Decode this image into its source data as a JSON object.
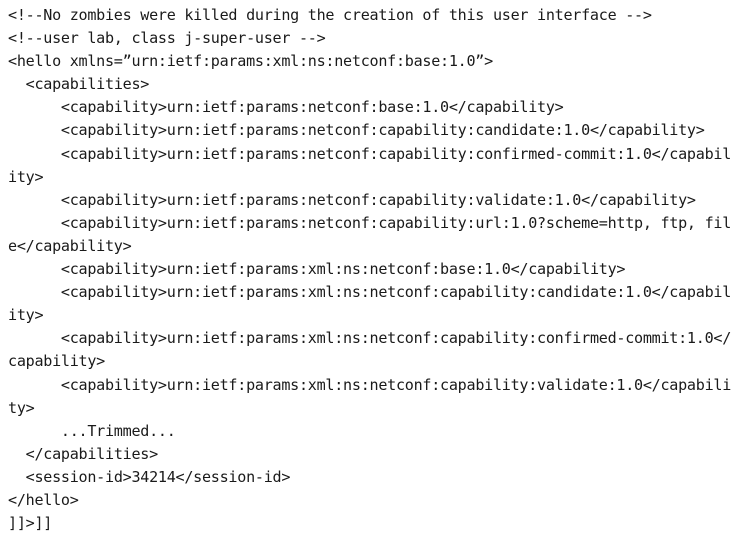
{
  "document": {
    "kind": "plain-text-code-listing",
    "language": "xml",
    "background_color": "#ffffff",
    "text_color": "#1a1a1a",
    "wrap_columns": 73,
    "line_count": 22,
    "lines": [
      "<!--No zombies were killed during the creation of this user interface -->",
      "<!--user lab, class j-super-user -->",
      "<hello xmlns=”urn:ietf:params:xml:ns:netconf:base:1.0”>",
      "  <capabilities>",
      "      <capability>urn:ietf:params:netconf:base:1.0</capability>",
      "      <capability>urn:ietf:params:netconf:capability:candidate:1.0</capability>",
      "      <capability>urn:ietf:params:netconf:capability:confirmed-commit:1.0</capability>",
      "      <capability>urn:ietf:params:netconf:capability:validate:1.0</capability>",
      "      <capability>urn:ietf:params:netconf:capability:url:1.0?scheme=http, ftp, file</capability>",
      "      <capability>urn:ietf:params:xml:ns:netconf:base:1.0</capability>",
      "      <capability>urn:ietf:params:xml:ns:netconf:capability:candidate:1.0</capability>",
      "      <capability>urn:ietf:params:xml:ns:netconf:capability:confirmed-commit:1.0</capability>",
      "      <capability>urn:ietf:params:xml:ns:netconf:capability:validate:1.0</capability>",
      "      ...Trimmed...",
      "  </capabilities>",
      "  <session-id>34214</session-id>",
      "</hello>",
      "]]>]]"
    ],
    "rendered_text": "<!--No zombies were killed during the creation of this user interface -->\n<!--user lab, class j-super-user -->\n<hello xmlns=”urn:ietf:params:xml:ns:netconf:base:1.0”>\n  <capabilities>\n      <capability>urn:ietf:params:netconf:base:1.0</capability>\n      <capability>urn:ietf:params:netconf:capability:candidate:1.0</capability>\n      <capability>urn:ietf:params:netconf:capability:confirmed-commit:1.0</capability>\n      <capability>urn:ietf:params:netconf:capability:validate:1.0</capability>\n      <capability>urn:ietf:params:netconf:capability:url:1.0?scheme=http, ftp, file</capability>\n      <capability>urn:ietf:params:xml:ns:netconf:base:1.0</capability>\n      <capability>urn:ietf:params:xml:ns:netconf:capability:candidate:1.0</capability>\n      <capability>urn:ietf:params:xml:ns:netconf:capability:confirmed-commit:1.0</capability>\n      <capability>urn:ietf:params:xml:ns:netconf:capability:validate:1.0</capability>\n      ...Trimmed...\n  </capabilities>\n  <session-id>34214</session-id>\n</hello>\n]]>]]",
    "session_id": "34214",
    "trimmed_marker": "...Trimmed...",
    "terminator": "]]>]]"
  }
}
